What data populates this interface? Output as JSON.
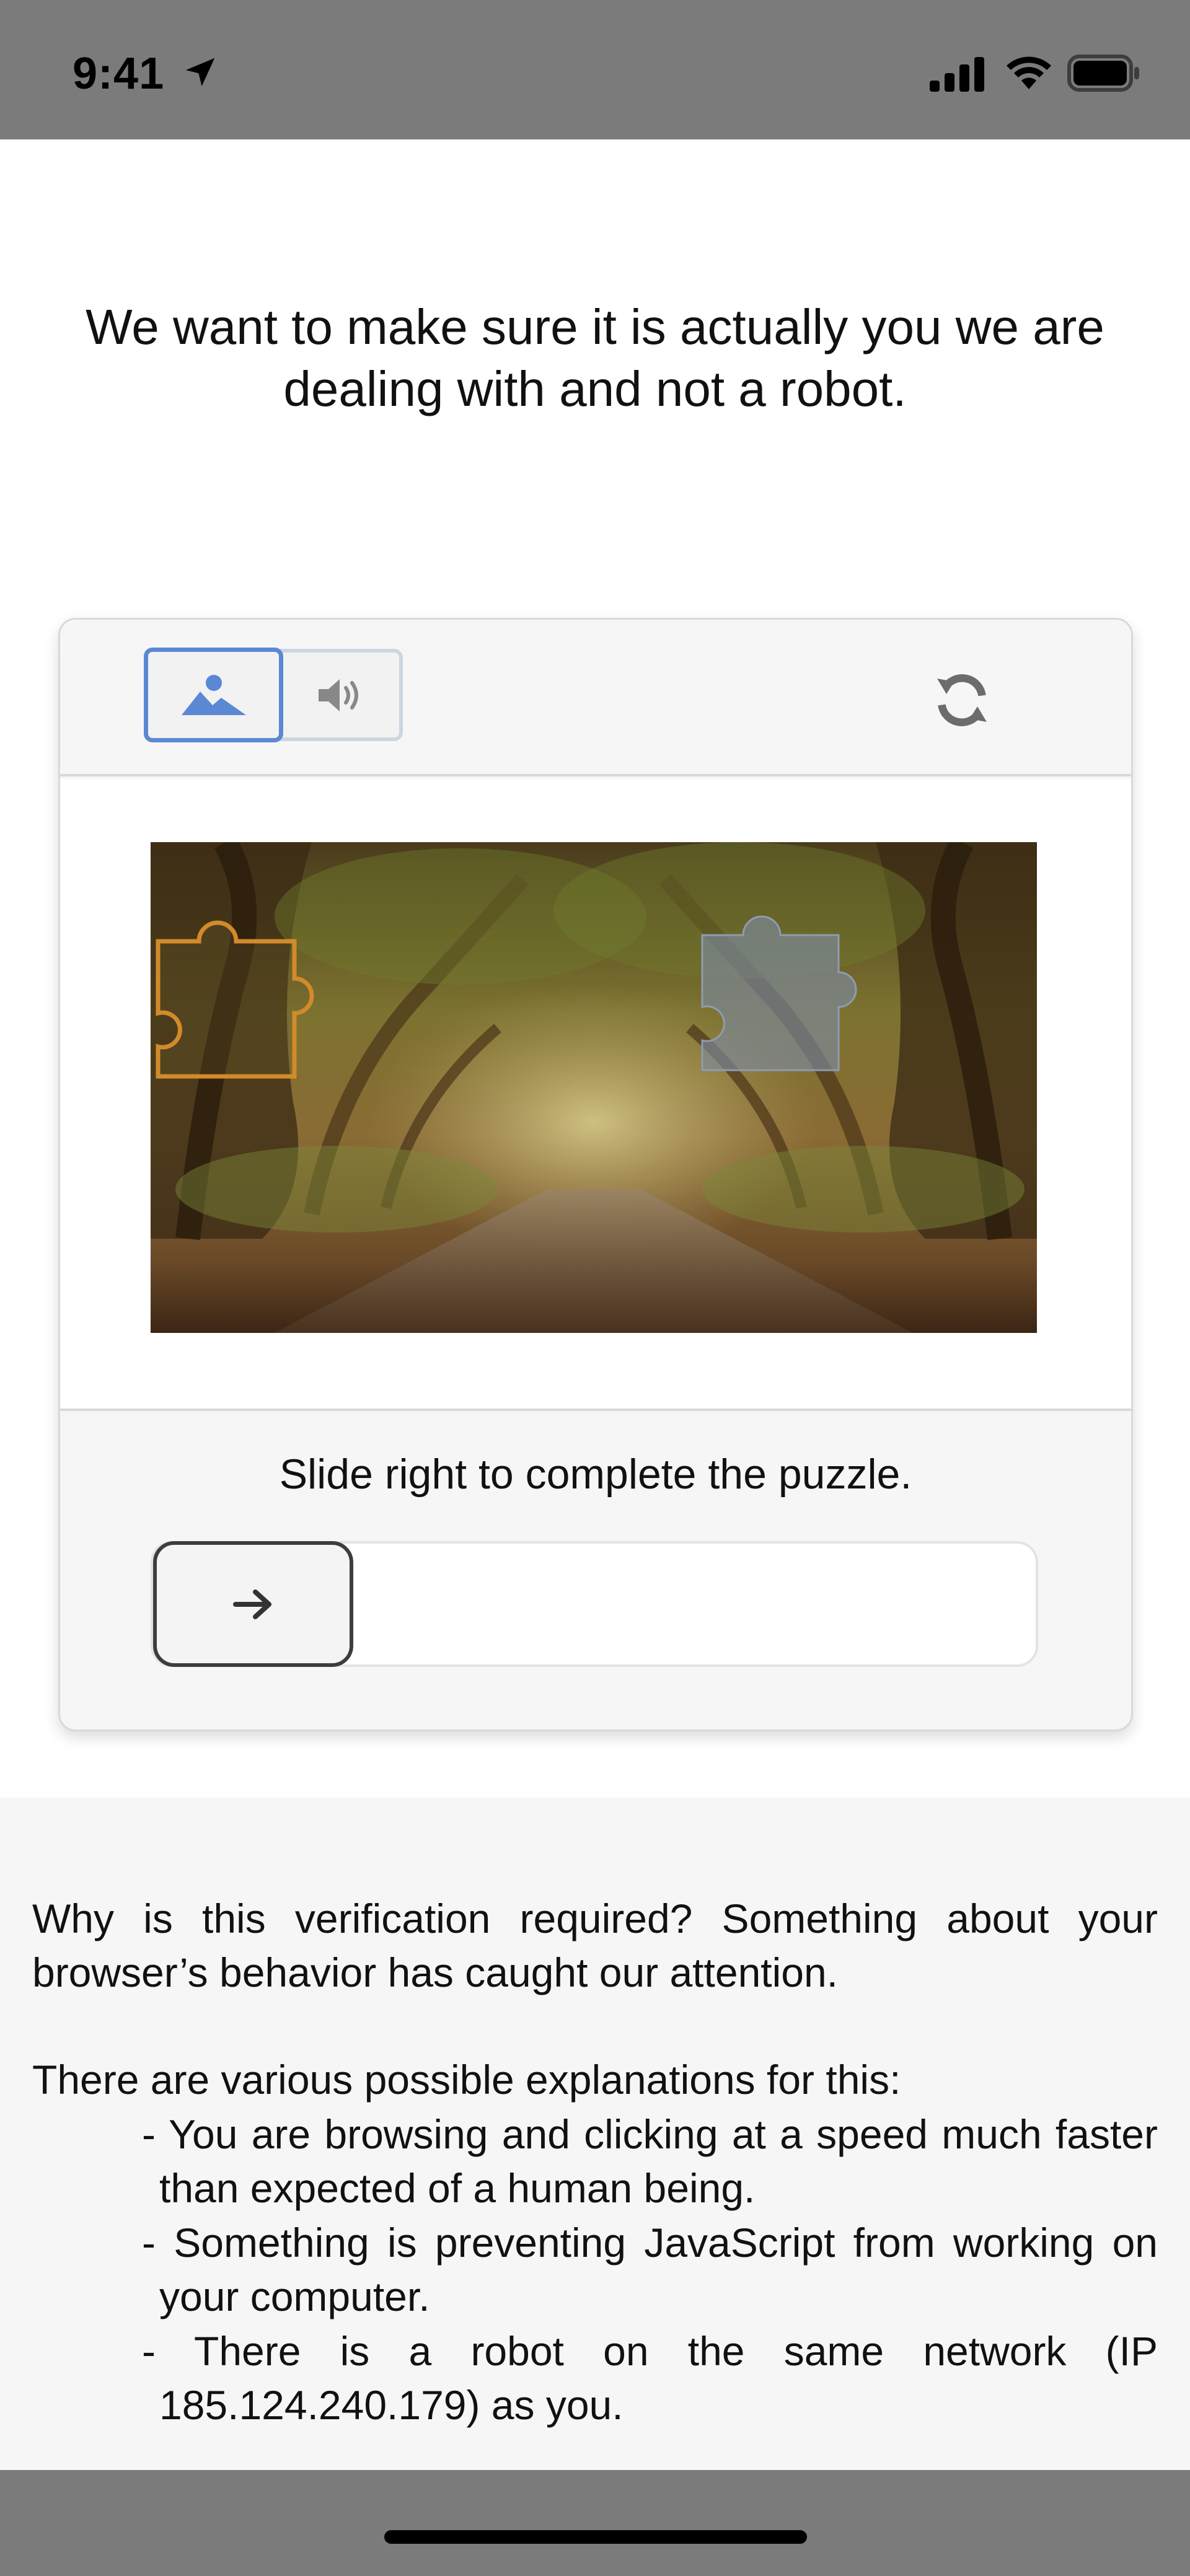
{
  "status_bar": {
    "time": "9:41",
    "icons": [
      "location-arrow-icon",
      "cellular-signal-icon",
      "wifi-icon",
      "battery-icon"
    ]
  },
  "headline": "We want to make sure it is actually you we are dealing with and not a robot.",
  "captcha": {
    "modes": [
      {
        "name": "image",
        "icon": "image-icon",
        "selected": true
      },
      {
        "name": "audio",
        "icon": "speaker-icon",
        "selected": false
      }
    ],
    "refresh_icon": "refresh-icon",
    "instruction": "Slide right to complete the puzzle.",
    "slider_icon": "arrow-right-icon",
    "slider_progress": 0
  },
  "explanation": {
    "question": "Why is this verification required? Something about your browser’s behavior has caught our attention.",
    "intro": "There are various possible explanations for this:",
    "reasons": [
      "- You are browsing and clicking at a speed much faster than expected of a human being.",
      "- Something is preventing JavaScript from working on your computer.",
      "- There is a robot on the same network (IP 185.124.240.179) as you."
    ]
  },
  "colors": {
    "status_bar": "#7b7b7b",
    "accent_blue": "#5b88d3",
    "card_bg": "#f6f6f6"
  }
}
